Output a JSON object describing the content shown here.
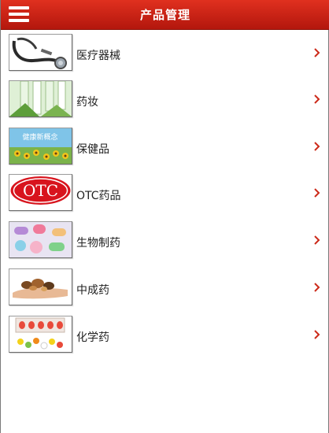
{
  "header": {
    "title": "产品管理",
    "menu_icon": "hamburger-menu-icon"
  },
  "thumb_texts": {
    "otc": "OTC",
    "health": "健康新概念"
  },
  "items": [
    {
      "label": "医疗器械",
      "icon": "stethoscope-image"
    },
    {
      "label": "药妆",
      "icon": "cosmetics-vials-image"
    },
    {
      "label": "保健品",
      "icon": "health-sunflowers-image"
    },
    {
      "label": "OTC药品",
      "icon": "otc-logo-image"
    },
    {
      "label": "生物制药",
      "icon": "colorful-capsules-image"
    },
    {
      "label": "中成药",
      "icon": "herbs-in-hand-image"
    },
    {
      "label": "化学药",
      "icon": "pill-blister-image"
    }
  ],
  "colors": {
    "header_top": "#e0301f",
    "header_bottom": "#b3170d",
    "chevron": "#cc2a1a"
  }
}
